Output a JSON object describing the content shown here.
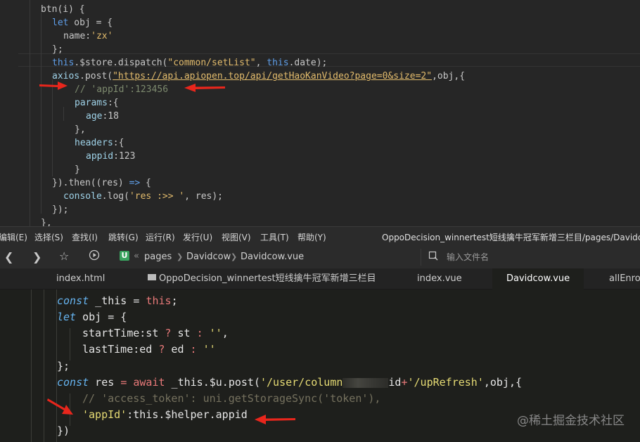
{
  "top_editor": {
    "lines": [
      {
        "parts": [
          [
            "t-sym",
            "btn(i) {"
          ]
        ]
      },
      {
        "parts": [
          [
            "t-kw",
            "let"
          ],
          [
            "t-sym",
            " obj = {"
          ]
        ]
      },
      {
        "parts": [
          [
            "t-sym",
            "name:"
          ],
          [
            "t-str",
            "'zx'"
          ]
        ]
      },
      {
        "parts": [
          [
            "t-sym",
            "};"
          ]
        ]
      },
      {
        "parts": [
          [
            "t-kw",
            "this"
          ],
          [
            "t-sym",
            ".$store.dispatch("
          ],
          [
            "t-str",
            "\"common/setList\""
          ],
          [
            "t-sym",
            ", "
          ],
          [
            "t-kw",
            "this"
          ],
          [
            "t-sym",
            ".date);"
          ]
        ]
      },
      {
        "parts": [
          [
            "t-prop",
            "axios"
          ],
          [
            "t-sym",
            ".post("
          ],
          [
            "t-str-u",
            "\"https://api.apiopen.top/api/getHaoKanVideo?page=0&size=2\""
          ],
          [
            "t-sym",
            ",obj,{"
          ]
        ]
      },
      {
        "parts": [
          [
            "t-cmt",
            "// 'appId':123456"
          ]
        ]
      },
      {
        "parts": [
          [
            "t-prop",
            "params"
          ],
          [
            "t-sym",
            ":{"
          ]
        ]
      },
      {
        "parts": [
          [
            "t-prop",
            "age"
          ],
          [
            "t-sym",
            ":18"
          ]
        ]
      },
      {
        "parts": [
          [
            "t-sym",
            "},"
          ]
        ]
      },
      {
        "parts": [
          [
            "t-prop",
            "headers"
          ],
          [
            "t-sym",
            ":{"
          ]
        ]
      },
      {
        "parts": [
          [
            "t-prop",
            "appid"
          ],
          [
            "t-sym",
            ":123"
          ]
        ]
      },
      {
        "parts": [
          [
            "t-sym",
            "}"
          ]
        ]
      },
      {
        "parts": [
          [
            "t-sym",
            "}).then((res) "
          ],
          [
            "t-kw",
            "=>"
          ],
          [
            "t-sym",
            " {"
          ]
        ]
      },
      {
        "parts": [
          [
            "t-prop",
            "console"
          ],
          [
            "t-sym",
            ".log("
          ],
          [
            "t-str",
            "'res :>> '"
          ],
          [
            "t-sym",
            ", res);"
          ]
        ]
      },
      {
        "parts": [
          [
            "t-sym",
            "});"
          ]
        ]
      },
      {
        "parts": [
          [
            "t-sym",
            "},"
          ]
        ]
      }
    ]
  },
  "menubar": {
    "items": [
      "编辑(E)",
      "选择(S)",
      "查找(I)",
      "跳转(G)",
      "运行(R)",
      "发行(U)",
      "视图(V)",
      "工具(T)",
      "帮助(Y)"
    ],
    "window_title": "OppoDecision_winnertest短线擒牛冠军新增三栏目/pages/Davidco"
  },
  "toolbar": {
    "badge": "U",
    "breadcrumb_prefix": "«",
    "crumbs": [
      "pages",
      "Davidcow",
      "Davidcow.vue"
    ],
    "search_placeholder": "输入文件名"
  },
  "tabs": [
    {
      "label": "index.html",
      "active": false
    },
    {
      "label": "OppoDecision_winnertest短线擒牛冠军新增三栏目",
      "active": false
    },
    {
      "label": "index.vue",
      "active": false
    },
    {
      "label": "Davidcow.vue",
      "active": true
    },
    {
      "label": "allEnrol",
      "active": false
    }
  ],
  "bottom_editor": {
    "line1": {
      "kw": "const",
      "a": " _this = ",
      "this": "this",
      "b": ";"
    },
    "line2": {
      "kw": "let",
      "a": " obj = {"
    },
    "line3": {
      "a": "startTime:st ",
      "q": "?",
      "b": " st ",
      "c": ":",
      "s": " ''",
      "d": ","
    },
    "line4": {
      "a": "lastTime:ed ",
      "q": "?",
      "b": " ed ",
      "c": ":",
      "s": " ''"
    },
    "line5": {
      "a": "};"
    },
    "line6": {
      "kw": "const",
      "a": " res ",
      "eq": "=",
      "aw": " await",
      "b": " _this.$u.post(",
      "s1": "'/user/column",
      "s2": "id",
      "plus": "+",
      "s3": "'/upRefresh'",
      "c": ",obj,{"
    },
    "line7": {
      "cmt": "// 'access_token': uni.getStorageSync('token'),"
    },
    "line8": {
      "s": "'appId'",
      "a": ":this.$helper.appid"
    },
    "line9": {
      "a": "})"
    }
  },
  "watermark": "@稀土掘金技术社区",
  "colors": {
    "arrow": "#e8261c",
    "editor_bg": "#1e1f1c",
    "top_bg": "#262626"
  }
}
